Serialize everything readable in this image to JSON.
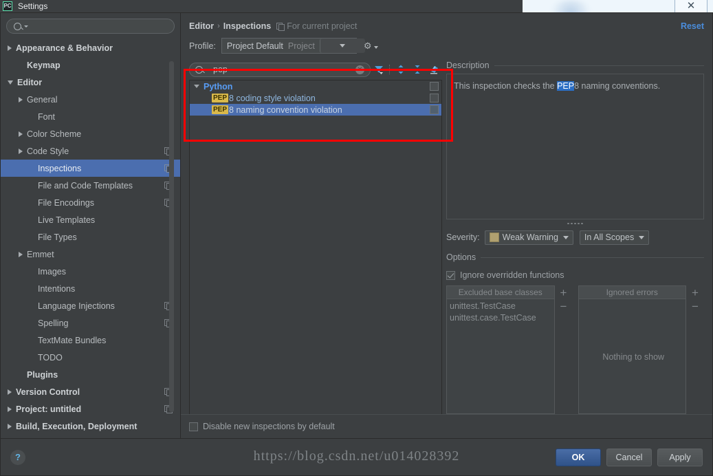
{
  "window": {
    "title": "Settings",
    "app_icon": "pycharm-icon",
    "close_label": "✕"
  },
  "sidebar": {
    "search": {
      "placeholder": "",
      "value": "",
      "icon": "search-icon"
    },
    "items": [
      {
        "label": "Appearance & Behavior",
        "arrow": "right",
        "bold": true,
        "indent": 0,
        "copy": false,
        "selected": false
      },
      {
        "label": "Keymap",
        "arrow": "none",
        "bold": true,
        "indent": 1,
        "copy": false,
        "selected": false
      },
      {
        "label": "Editor",
        "arrow": "down",
        "bold": true,
        "indent": 0,
        "copy": false,
        "selected": false
      },
      {
        "label": "General",
        "arrow": "right",
        "bold": false,
        "indent": 1,
        "copy": false,
        "selected": false
      },
      {
        "label": "Font",
        "arrow": "none",
        "bold": false,
        "indent": 2,
        "copy": false,
        "selected": false
      },
      {
        "label": "Color Scheme",
        "arrow": "right",
        "bold": false,
        "indent": 1,
        "copy": false,
        "selected": false
      },
      {
        "label": "Code Style",
        "arrow": "right",
        "bold": false,
        "indent": 1,
        "copy": true,
        "selected": false
      },
      {
        "label": "Inspections",
        "arrow": "none",
        "bold": false,
        "indent": 2,
        "copy": true,
        "selected": true
      },
      {
        "label": "File and Code Templates",
        "arrow": "none",
        "bold": false,
        "indent": 2,
        "copy": true,
        "selected": false
      },
      {
        "label": "File Encodings",
        "arrow": "none",
        "bold": false,
        "indent": 2,
        "copy": true,
        "selected": false
      },
      {
        "label": "Live Templates",
        "arrow": "none",
        "bold": false,
        "indent": 2,
        "copy": false,
        "selected": false
      },
      {
        "label": "File Types",
        "arrow": "none",
        "bold": false,
        "indent": 2,
        "copy": false,
        "selected": false
      },
      {
        "label": "Emmet",
        "arrow": "right",
        "bold": false,
        "indent": 1,
        "copy": false,
        "selected": false
      },
      {
        "label": "Images",
        "arrow": "none",
        "bold": false,
        "indent": 2,
        "copy": false,
        "selected": false
      },
      {
        "label": "Intentions",
        "arrow": "none",
        "bold": false,
        "indent": 2,
        "copy": false,
        "selected": false
      },
      {
        "label": "Language Injections",
        "arrow": "none",
        "bold": false,
        "indent": 2,
        "copy": true,
        "selected": false
      },
      {
        "label": "Spelling",
        "arrow": "none",
        "bold": false,
        "indent": 2,
        "copy": true,
        "selected": false
      },
      {
        "label": "TextMate Bundles",
        "arrow": "none",
        "bold": false,
        "indent": 2,
        "copy": false,
        "selected": false
      },
      {
        "label": "TODO",
        "arrow": "none",
        "bold": false,
        "indent": 2,
        "copy": false,
        "selected": false
      },
      {
        "label": "Plugins",
        "arrow": "none",
        "bold": true,
        "indent": 1,
        "copy": false,
        "selected": false
      },
      {
        "label": "Version Control",
        "arrow": "right",
        "bold": true,
        "indent": 0,
        "copy": true,
        "selected": false
      },
      {
        "label": "Project: untitled",
        "arrow": "right",
        "bold": true,
        "indent": 0,
        "copy": true,
        "selected": false
      },
      {
        "label": "Build, Execution, Deployment",
        "arrow": "right",
        "bold": true,
        "indent": 0,
        "copy": false,
        "selected": false
      }
    ]
  },
  "header": {
    "breadcrumb_root": "Editor",
    "breadcrumb_sep": "›",
    "breadcrumb_leaf": "Inspections",
    "scope_note": "For current project",
    "scope_icon": "copy-icon",
    "reset_label": "Reset"
  },
  "profile": {
    "label": "Profile:",
    "value": "Project Default",
    "hint": "Project",
    "dropdown_icon": "chevron-down-icon",
    "gear_icon": "gear-icon"
  },
  "inspections": {
    "search_value": "pep",
    "search_icon": "search-icon",
    "clear_icon": "clear-icon",
    "toolbar": [
      {
        "name": "filter-icon",
        "title": "Filter"
      },
      {
        "name": "expand-all-icon",
        "title": "Expand All"
      },
      {
        "name": "collapse-all-icon",
        "title": "Collapse All"
      },
      {
        "name": "eraser-icon",
        "title": "Reset to Empty"
      }
    ],
    "tree": [
      {
        "kind": "group",
        "label": "Python",
        "arrow": "down",
        "selected": false,
        "checked": false
      },
      {
        "kind": "leaf",
        "badge": "PEP",
        "label": "8 coding style violation",
        "selected": false,
        "checked": false
      },
      {
        "kind": "leaf",
        "badge": "PEP",
        "label": "8 naming convention violation",
        "selected": true,
        "checked": false
      }
    ]
  },
  "description": {
    "title": "Description",
    "text_before": "This inspection checks the ",
    "highlight": "PEP",
    "text_after": "8 naming conventions."
  },
  "severity": {
    "label": "Severity:",
    "value": "Weak Warning",
    "swatch_color": "#b0a070",
    "scope_value": "In All Scopes",
    "dropdown_icon": "chevron-down-icon"
  },
  "options": {
    "title": "Options",
    "ignore_overridden": {
      "label": "Ignore overridden functions",
      "checked": true
    },
    "excluded": {
      "title": "Excluded base classes",
      "items": [
        "unittest.TestCase",
        "unittest.case.TestCase"
      ],
      "add_label": "+",
      "remove_label": "−"
    },
    "ignored_errors": {
      "title": "Ignored errors",
      "items": [],
      "empty_text": "Nothing to show",
      "add_label": "+",
      "remove_label": "−"
    }
  },
  "bottom": {
    "disable_new": {
      "label": "Disable new inspections by default",
      "checked": false
    }
  },
  "footer": {
    "help_label": "?",
    "ok_label": "OK",
    "cancel_label": "Cancel",
    "apply_label": "Apply",
    "watermark": "https://blog.csdn.net/u014028392"
  }
}
